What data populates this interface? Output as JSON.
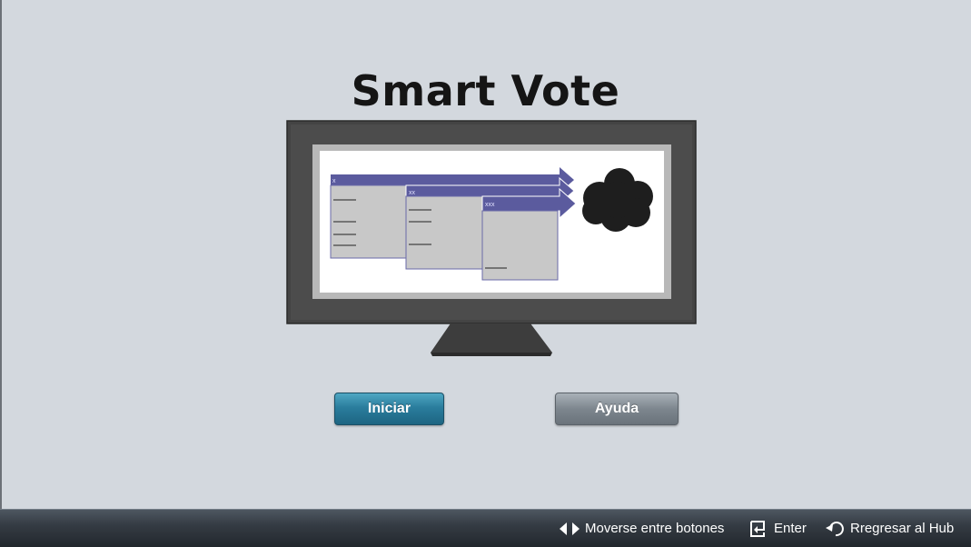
{
  "page": {
    "title": "Smart Vote"
  },
  "illustration": {
    "window_labels": [
      "x",
      "xx",
      "xxx"
    ]
  },
  "buttons": {
    "start_label": "Iniciar",
    "help_label": "Ayuda"
  },
  "footer": {
    "move_label": "Moverse entre botones",
    "enter_label": "Enter",
    "back_label": "Rregresar al Hub"
  },
  "colors": {
    "background": "#d3d8de",
    "start_button": "#2a7d9d",
    "help_button": "#7d868e",
    "footer_bar": "#2e353d",
    "window_header": "#5b5b9e"
  },
  "icons": {
    "move": "left-right-arrows-icon",
    "enter": "enter-icon",
    "back": "return-arrow-icon"
  }
}
